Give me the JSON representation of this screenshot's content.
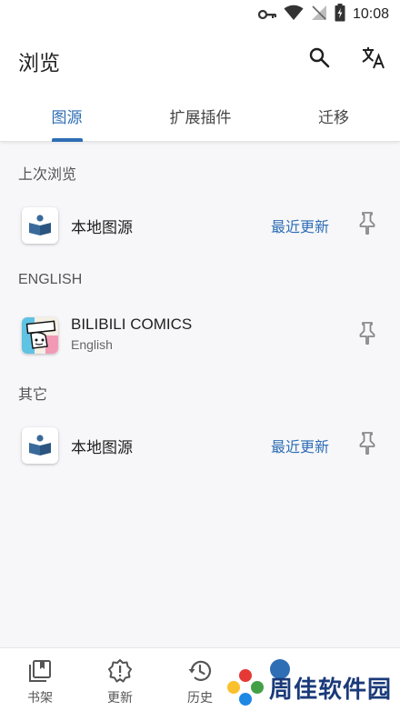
{
  "status_bar": {
    "time": "10:08",
    "icons": [
      "key-icon",
      "wifi-icon",
      "no-signal-icon",
      "battery-charging-icon"
    ]
  },
  "app_bar": {
    "title": "浏览",
    "actions": [
      "search-icon",
      "translate-icon"
    ]
  },
  "tabs": [
    {
      "label": "图源",
      "active": true
    },
    {
      "label": "扩展插件",
      "active": false
    },
    {
      "label": "迁移",
      "active": false
    }
  ],
  "sections": [
    {
      "header": "上次浏览",
      "items": [
        {
          "name": "本地图源",
          "action": "最近更新",
          "icon": "local-source-icon"
        }
      ]
    },
    {
      "header": "ENGLISH",
      "items": [
        {
          "name": "BILIBILI COMICS",
          "language": "English",
          "icon": "bilibili-comics-icon"
        }
      ]
    },
    {
      "header": "其它",
      "items": [
        {
          "name": "本地图源",
          "action": "最近更新",
          "icon": "local-source-icon"
        }
      ]
    }
  ],
  "bottom_nav": [
    {
      "label": "书架",
      "icon": "library-icon"
    },
    {
      "label": "更新",
      "icon": "updates-alert-icon"
    },
    {
      "label": "历史",
      "icon": "history-icon"
    }
  ],
  "watermark": {
    "text": "周佳软件园"
  },
  "colors": {
    "accent": "#2e6eb5",
    "background": "#f7f7f9",
    "surface": "#ffffff"
  }
}
